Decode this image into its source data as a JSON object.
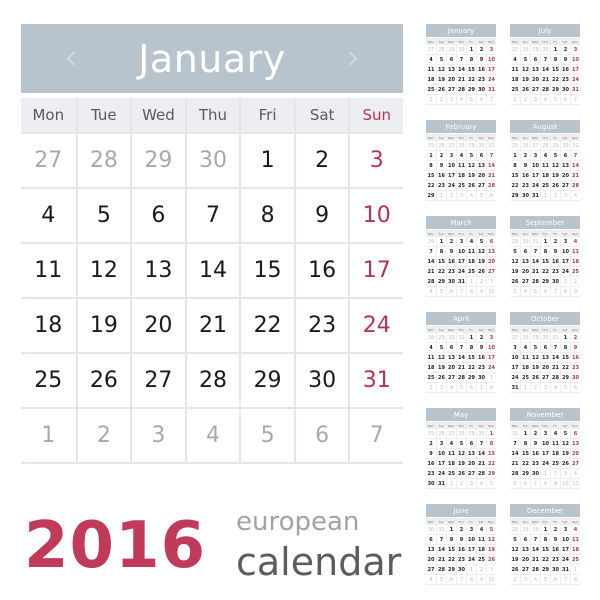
{
  "main": {
    "month": "January",
    "prev_icon": "chevron-left-icon",
    "next_icon": "chevron-right-icon",
    "weekdays": [
      "Mon",
      "Tue",
      "Wed",
      "Thu",
      "Fri",
      "Sat",
      "Sun"
    ],
    "weeks": [
      [
        {
          "d": "27",
          "o": true
        },
        {
          "d": "28",
          "o": true
        },
        {
          "d": "29",
          "o": true
        },
        {
          "d": "30",
          "o": true
        },
        {
          "d": "1"
        },
        {
          "d": "2"
        },
        {
          "d": "3"
        }
      ],
      [
        {
          "d": "4"
        },
        {
          "d": "5"
        },
        {
          "d": "6"
        },
        {
          "d": "7"
        },
        {
          "d": "8"
        },
        {
          "d": "9"
        },
        {
          "d": "10"
        }
      ],
      [
        {
          "d": "11"
        },
        {
          "d": "12"
        },
        {
          "d": "13"
        },
        {
          "d": "14"
        },
        {
          "d": "15"
        },
        {
          "d": "16"
        },
        {
          "d": "17"
        }
      ],
      [
        {
          "d": "18"
        },
        {
          "d": "19"
        },
        {
          "d": "20"
        },
        {
          "d": "21"
        },
        {
          "d": "22"
        },
        {
          "d": "23"
        },
        {
          "d": "24"
        }
      ],
      [
        {
          "d": "25"
        },
        {
          "d": "26"
        },
        {
          "d": "27"
        },
        {
          "d": "28"
        },
        {
          "d": "29"
        },
        {
          "d": "30"
        },
        {
          "d": "31"
        }
      ],
      [
        {
          "d": "1",
          "o": true
        },
        {
          "d": "2",
          "o": true
        },
        {
          "d": "3",
          "o": true
        },
        {
          "d": "4",
          "o": true
        },
        {
          "d": "5",
          "o": true
        },
        {
          "d": "6",
          "o": true
        },
        {
          "d": "7",
          "o": true
        }
      ]
    ]
  },
  "title": {
    "year": "2016",
    "line1": "european",
    "line2": "calendar"
  },
  "colors": {
    "accent": "#c23a5a",
    "sunday": "#b8324f",
    "header_bg": "#b7c3cd",
    "other_month": "#a9a9a9"
  },
  "mini_weekdays": [
    "Mon",
    "Tue",
    "Wed",
    "Thu",
    "Fri",
    "Sat",
    "Sun"
  ],
  "mini_months": [
    {
      "name": "January",
      "col": 0,
      "row": 0,
      "lead": [
        "27",
        "28",
        "29",
        "30"
      ],
      "days": 31
    },
    {
      "name": "February",
      "col": 0,
      "row": 1,
      "lead": [
        "25",
        "26",
        "27",
        "28",
        "29",
        "30",
        "31"
      ],
      "days": 29
    },
    {
      "name": "March",
      "col": 0,
      "row": 2,
      "lead": [
        "29"
      ],
      "days": 31
    },
    {
      "name": "April",
      "col": 0,
      "row": 3,
      "lead": [
        "28",
        "29",
        "30",
        "31"
      ],
      "days": 30
    },
    {
      "name": "May",
      "col": 0,
      "row": 4,
      "lead": [
        "25",
        "26",
        "27",
        "28",
        "29",
        "30"
      ],
      "days": 31
    },
    {
      "name": "June",
      "col": 0,
      "row": 5,
      "lead": [
        "30",
        "31"
      ],
      "days": 30
    },
    {
      "name": "July",
      "col": 1,
      "row": 0,
      "lead": [
        "27",
        "28",
        "29",
        "30"
      ],
      "days": 31
    },
    {
      "name": "August",
      "col": 1,
      "row": 1,
      "lead": [
        "25",
        "26",
        "27",
        "28",
        "29",
        "30",
        "31"
      ],
      "days": 31
    },
    {
      "name": "September",
      "col": 1,
      "row": 2,
      "lead": [
        "29",
        "30",
        "31"
      ],
      "days": 30
    },
    {
      "name": "October",
      "col": 1,
      "row": 3,
      "lead": [
        "27",
        "28",
        "29",
        "30",
        "31"
      ],
      "days": 31
    },
    {
      "name": "November",
      "col": 1,
      "row": 4,
      "lead": [
        "31"
      ],
      "days": 30
    },
    {
      "name": "December",
      "col": 1,
      "row": 5,
      "lead": [
        "28",
        "29",
        "30"
      ],
      "days": 31
    }
  ]
}
